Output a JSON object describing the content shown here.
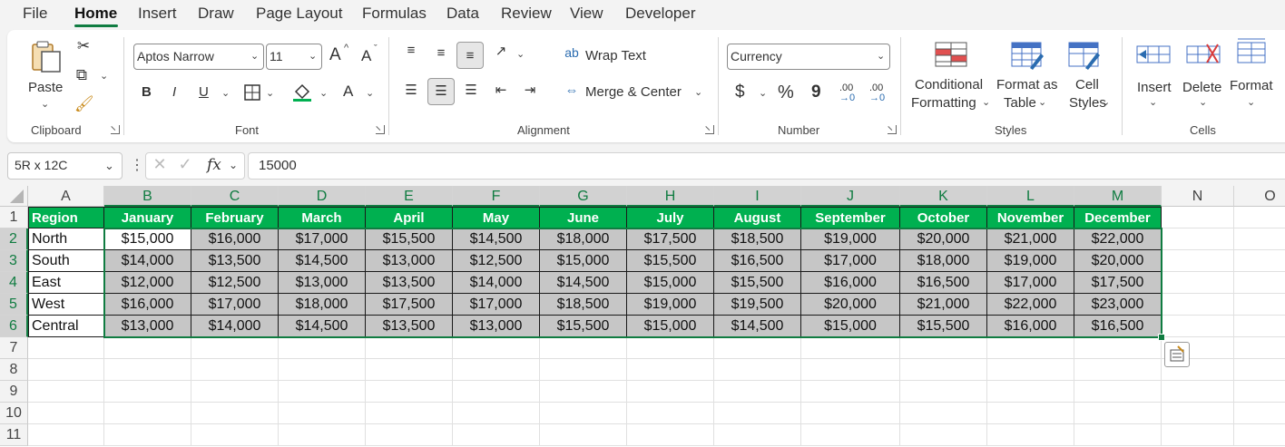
{
  "menu": {
    "file": "File",
    "home": "Home",
    "insert": "Insert",
    "draw": "Draw",
    "page_layout": "Page Layout",
    "formulas": "Formulas",
    "data": "Data",
    "review": "Review",
    "view": "View",
    "developer": "Developer"
  },
  "ribbon": {
    "clipboard": {
      "paste": "Paste",
      "label": "Clipboard"
    },
    "font": {
      "family": "Aptos Narrow",
      "size": "11",
      "bold": "B",
      "italic": "I",
      "underline": "U",
      "grow": "A",
      "shrink": "A",
      "font_color_letter": "A",
      "label": "Font"
    },
    "alignment": {
      "wrap_text": "Wrap Text",
      "merge_center": "Merge & Center",
      "label": "Alignment"
    },
    "number": {
      "format": "Currency",
      "currency_symbol": "$",
      "percent": "%",
      "comma": "9",
      "inc_decimal_top": ".00",
      "inc_decimal_bottom": "→0",
      "dec_decimal_top": ".00",
      "dec_decimal_bottom": "→0",
      "label": "Number"
    },
    "styles": {
      "conditional_1": "Conditional",
      "conditional_2": "Formatting",
      "format_table_1": "Format as",
      "format_table_2": "Table",
      "cell_styles_1": "Cell",
      "cell_styles_2": "Styles",
      "label": "Styles"
    },
    "cells": {
      "insert": "Insert",
      "delete": "Delete",
      "format": "Format",
      "label": "Cells"
    }
  },
  "formula_bar": {
    "name_box": "5R x 12C",
    "fx": "fx",
    "value": "15000"
  },
  "columns": [
    "A",
    "B",
    "C",
    "D",
    "E",
    "F",
    "G",
    "H",
    "I",
    "J",
    "K",
    "L",
    "M",
    "N",
    "O"
  ],
  "rows": [
    "1",
    "2",
    "3",
    "4",
    "5",
    "6",
    "7",
    "8",
    "9",
    "10",
    "11"
  ],
  "table": {
    "headers": [
      "Region",
      "January",
      "February",
      "March",
      "April",
      "May",
      "June",
      "July",
      "August",
      "September",
      "October",
      "November",
      "December"
    ],
    "data": [
      [
        "North",
        "$15,000",
        "$16,000",
        "$17,000",
        "$15,500",
        "$14,500",
        "$18,000",
        "$17,500",
        "$18,500",
        "$19,000",
        "$20,000",
        "$21,000",
        "$22,000"
      ],
      [
        "South",
        "$14,000",
        "$13,500",
        "$14,500",
        "$13,000",
        "$12,500",
        "$15,000",
        "$15,500",
        "$16,500",
        "$17,000",
        "$18,000",
        "$19,000",
        "$20,000"
      ],
      [
        "East",
        "$12,000",
        "$12,500",
        "$13,000",
        "$13,500",
        "$14,000",
        "$14,500",
        "$15,000",
        "$15,500",
        "$16,000",
        "$16,500",
        "$17,000",
        "$17,500"
      ],
      [
        "West",
        "$16,000",
        "$17,000",
        "$18,000",
        "$17,500",
        "$17,000",
        "$18,500",
        "$19,000",
        "$19,500",
        "$20,000",
        "$21,000",
        "$22,000",
        "$23,000"
      ],
      [
        "Central",
        "$13,000",
        "$14,000",
        "$14,500",
        "$13,500",
        "$13,000",
        "$15,500",
        "$15,000",
        "$14,500",
        "$15,000",
        "$15,500",
        "$16,000",
        "$16,500"
      ]
    ]
  },
  "colors": {
    "accent": "#107c41",
    "header_fill": "#00b050",
    "selection_fill": "#c6c6c6"
  }
}
